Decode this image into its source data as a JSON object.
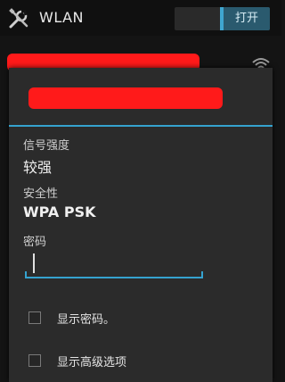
{
  "topbar": {
    "title": "WLAN",
    "toggle_label": "打开",
    "toggle_state": "on",
    "icon": "wrench-screwdriver-icon"
  },
  "background_list": {
    "icon": "wifi-signal-icon"
  },
  "dialog": {
    "title_redacted": true,
    "signal_strength": {
      "label": "信号强度",
      "value": "较强"
    },
    "security": {
      "label": "安全性",
      "value": "WPA PSK"
    },
    "password": {
      "label": "密码",
      "value": ""
    },
    "show_password": {
      "label": "显示密码。",
      "checked": false
    },
    "advanced_options": {
      "label": "显示高级选项",
      "checked": false
    }
  },
  "colors": {
    "accent": "#35a2cf",
    "redaction": "#ff1a1a",
    "dialog_bg": "#2b2b2b",
    "screen_bg": "#141414"
  }
}
